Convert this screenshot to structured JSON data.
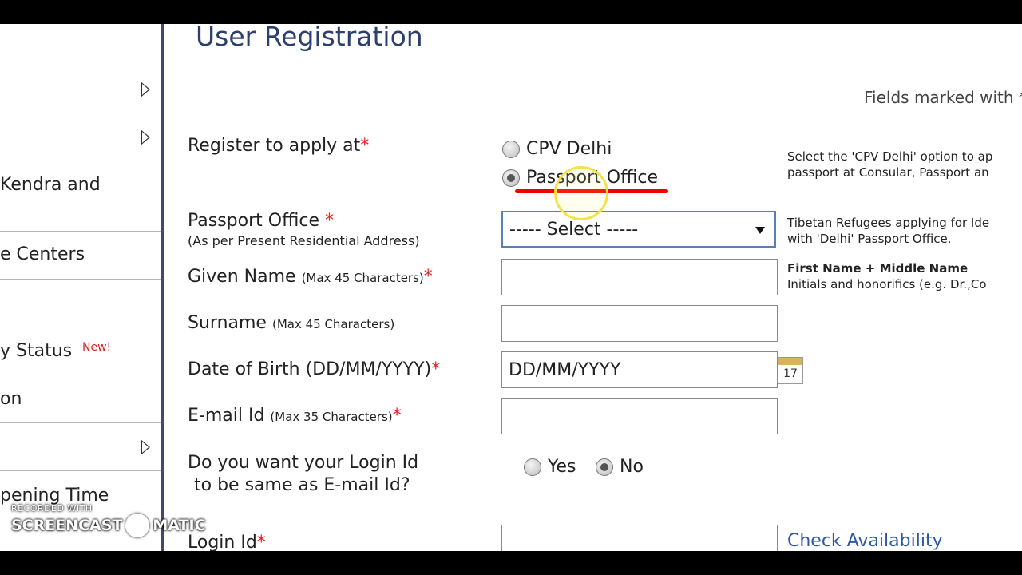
{
  "sidebar": {
    "items": [
      {
        "label": "",
        "arrow": true
      },
      {
        "label": "",
        "arrow": true
      },
      {
        "label": "Kendra and",
        "arrow": false
      },
      {
        "label": "e Centers",
        "arrow": false
      },
      {
        "label": "",
        "arrow": false
      },
      {
        "label": "y Status",
        "badge": "New!",
        "arrow": false
      },
      {
        "label": "on",
        "arrow": false
      },
      {
        "label": "",
        "arrow": true
      },
      {
        "label": "pening Time",
        "arrow": false
      }
    ]
  },
  "main": {
    "title": "User Registration",
    "fields_note": "Fields marked with *",
    "register_at": {
      "label": "Register to apply at",
      "options": [
        {
          "label": "CPV Delhi",
          "checked": false
        },
        {
          "label": "Passport Office",
          "checked": true
        }
      ],
      "help_line1": "Select the 'CPV Delhi' option to ap",
      "help_line2": "passport at Consular, Passport an"
    },
    "passport_office": {
      "label": "Passport Office",
      "sublabel": "(As per Present Residential Address)",
      "value": "----- Select -----",
      "help_line1": "Tibetan Refugees applying for Ide",
      "help_line2": "with 'Delhi' Passport Office."
    },
    "given_name": {
      "label": "Given Name",
      "hint": "(Max 45 Characters)",
      "value": "",
      "help_title": "First Name + Middle Name",
      "help_line": "Initials and honorifics (e.g. Dr.,Co"
    },
    "surname": {
      "label": "Surname",
      "hint": "(Max 45 Characters)",
      "value": ""
    },
    "dob": {
      "label": "Date of Birth (DD/MM/YYYY)",
      "value": "DD/MM/YYYY",
      "calendar_day": "17"
    },
    "email": {
      "label": "E-mail Id",
      "hint": "(Max 35 Characters)",
      "value": ""
    },
    "login_same": {
      "label_line1": "Do you want your Login Id",
      "label_line2": "to be same as E-mail Id?",
      "options": [
        {
          "label": "Yes",
          "checked": false
        },
        {
          "label": "No",
          "checked": true
        }
      ]
    },
    "login_id": {
      "label": "Login Id",
      "value": "",
      "check_link": "Check Availability"
    },
    "required_mark": "*"
  },
  "watermark": {
    "small": "RECORDED WITH",
    "brand_left": "SCREENCAST",
    "brand_right": "MATIC"
  },
  "colors": {
    "title": "#2d3f6c",
    "required": "#e02020",
    "link": "#2d5aa8",
    "sidebar_border": "#3f4b6b",
    "annotation": "#e00000"
  }
}
